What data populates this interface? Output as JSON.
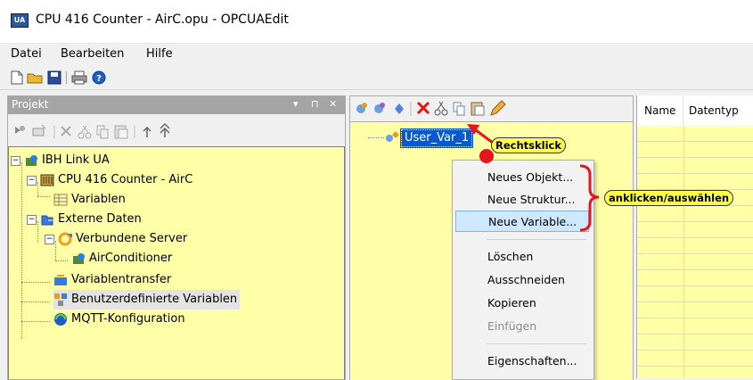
{
  "window": {
    "title": "CPU 416 Counter - AirC.opu - OPCUAEdit"
  },
  "menubar": {
    "items": [
      "Datei",
      "Bearbeiten",
      "Hilfe"
    ]
  },
  "project_panel": {
    "title": "Projekt",
    "controls": [
      "▾",
      "⊓",
      "✕"
    ],
    "tree": [
      {
        "label": "IBH Link UA"
      },
      {
        "label": "CPU 416 Counter - AirC"
      },
      {
        "label": "Variablen"
      },
      {
        "label": "Externe Daten"
      },
      {
        "label": "Verbundene Server"
      },
      {
        "label": "AirConditioner"
      },
      {
        "label": "Variablentransfer"
      },
      {
        "label": "Benutzerdefinierte Variablen"
      },
      {
        "label": "MQTT-Konfiguration"
      }
    ]
  },
  "middle_panel": {
    "node_label": "User_Var_1"
  },
  "right_panel": {
    "columns": [
      "Name",
      "Datentyp"
    ]
  },
  "context_menu": {
    "items": [
      "Neues Objekt...",
      "Neue Struktur...",
      "Neue Variable...",
      "Löschen",
      "Ausschneiden",
      "Kopieren",
      "Einfügen",
      "Eigenschaften..."
    ]
  },
  "annotations": {
    "right_click": "Rechtsklick",
    "click_select": "anklicken/auswählen"
  },
  "colors": {
    "tree_bg": "#ffffa8",
    "selection": "#0a58cf",
    "callout": "#ffff4a",
    "brace": "#e8141e"
  }
}
